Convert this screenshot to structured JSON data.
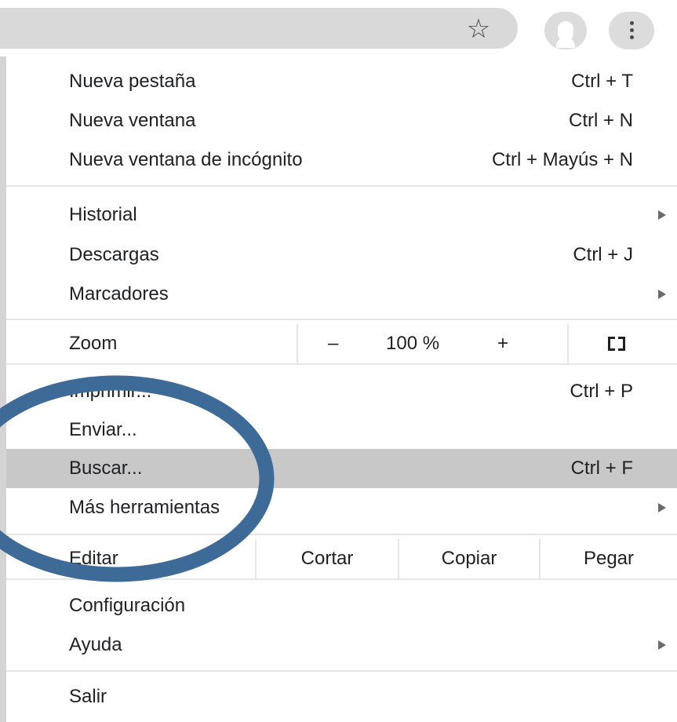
{
  "toolbar": {
    "icons": [
      "star-icon",
      "profile-avatar-icon",
      "menu-kebab-icon"
    ]
  },
  "menu": {
    "items": [
      {
        "label": "Nueva pestaña",
        "shortcut": "Ctrl + T"
      },
      {
        "label": "Nueva ventana",
        "shortcut": "Ctrl + N"
      },
      {
        "label": "Nueva ventana de incógnito",
        "shortcut": "Ctrl + Mayús + N"
      },
      {
        "label": "Historial",
        "shortcut": ""
      },
      {
        "label": "Descargas",
        "shortcut": "Ctrl + J"
      },
      {
        "label": "Marcadores",
        "shortcut": ""
      },
      {
        "label": "Imprimir...",
        "shortcut": "Ctrl + P"
      },
      {
        "label": "Enviar...",
        "shortcut": ""
      },
      {
        "label": "Buscar...",
        "shortcut": "Ctrl + F"
      },
      {
        "label": "Más herramientas",
        "shortcut": ""
      },
      {
        "label": "Configuración",
        "shortcut": ""
      },
      {
        "label": "Ayuda",
        "shortcut": ""
      },
      {
        "label": "Salir",
        "shortcut": ""
      }
    ],
    "zoom": {
      "label": "Zoom",
      "minus": "–",
      "value": "100 %",
      "plus": "+"
    },
    "edit": {
      "label": "Editar",
      "cut": "Cortar",
      "copy": "Copiar",
      "paste": "Pegar"
    }
  },
  "colors": {
    "highlight": "#c8c8c8",
    "annotation": "#3d6a97"
  }
}
